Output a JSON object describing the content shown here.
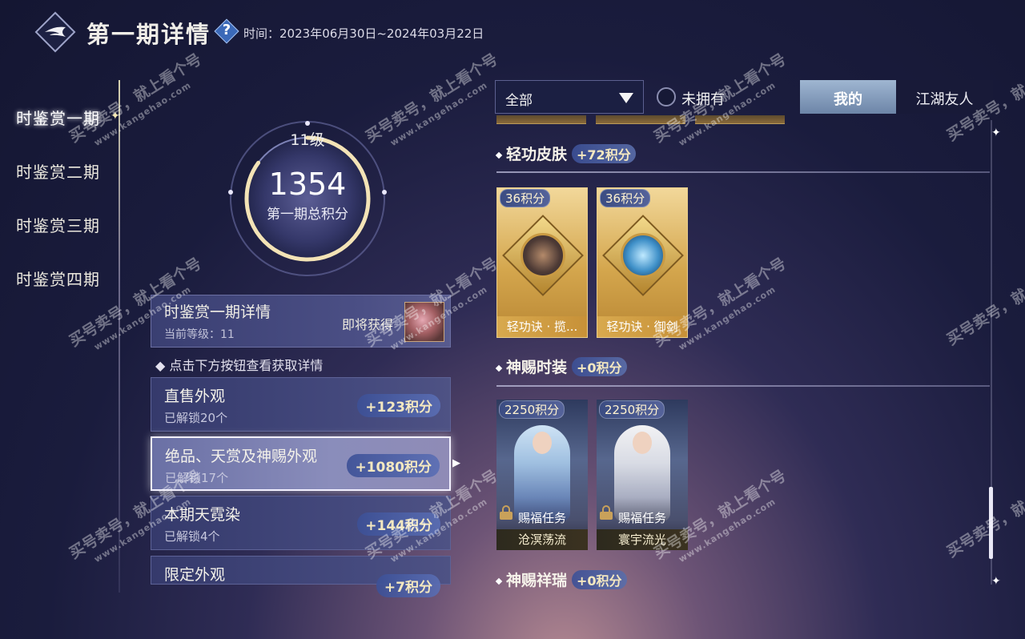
{
  "header": {
    "title": "第一期详情",
    "help_label": "?",
    "time_label": "时间：",
    "time_range": "2023年06月30日~2024年03月22日"
  },
  "nav": {
    "items": [
      {
        "label": "时鉴赏一期"
      },
      {
        "label": "时鉴赏二期"
      },
      {
        "label": "时鉴赏三期"
      },
      {
        "label": "时鉴赏四期"
      }
    ],
    "active_index": 0
  },
  "score": {
    "level": "11级",
    "total": "1354",
    "label": "第一期总积分",
    "progress": 0.85
  },
  "detail": {
    "title": "时鉴赏一期详情",
    "sub": "当前等级：11",
    "soon": "即将获得"
  },
  "hint": "点击下方按钮查看获取详情",
  "categories": [
    {
      "title": "直售外观",
      "sub": "已解锁20个",
      "points": "+123积分"
    },
    {
      "title": "绝品、天赏及神赐外观",
      "sub": "已解锁17个",
      "points": "+1080积分"
    },
    {
      "title": "本期天霓染",
      "sub": "已解锁4个",
      "points": "+144积分"
    },
    {
      "title": "限定外观",
      "sub": "",
      "points": "+7积分"
    }
  ],
  "selected_category": 1,
  "filter": {
    "selected": "全部",
    "unowned_label": "未拥有",
    "unowned_checked": false
  },
  "tabs": {
    "mine": "我的",
    "friends": "江湖友人",
    "active": "mine"
  },
  "sections": [
    {
      "title": "轻功皮肤",
      "points": "+72积分",
      "cards": [
        {
          "points": "36积分",
          "name": "轻功诀 · 揽..."
        },
        {
          "points": "36积分",
          "name": "轻功诀 · 御剑"
        }
      ]
    },
    {
      "title": "神赐时装",
      "points": "+0积分",
      "cards": [
        {
          "points": "2250积分",
          "task": "赐福任务",
          "name": "沧溟荡流"
        },
        {
          "points": "2250积分",
          "task": "赐福任务",
          "name": "寰宇流光"
        }
      ]
    },
    {
      "title": "神赐祥瑞",
      "points": "+0积分"
    }
  ],
  "watermark": {
    "text": "买号卖号，就上看个号",
    "site": "www.kangehao.com",
    "badge": "看个号"
  },
  "colors": {
    "accent_gold": "#f4e8c0",
    "panel": "#454a7e",
    "selected": "#8a8dbb",
    "tab_active": "#9fb6d1",
    "skin_card": "#d4a64d"
  }
}
